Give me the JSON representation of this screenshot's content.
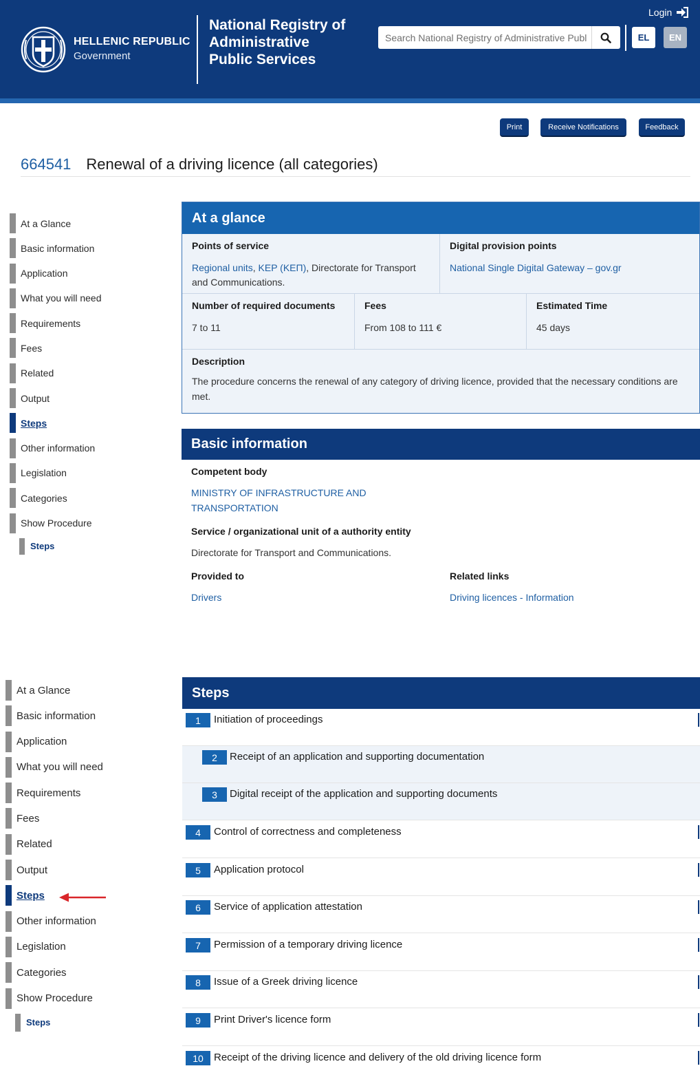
{
  "header": {
    "gov_title": "HELLENIC REPUBLIC",
    "gov_subtitle": "Government",
    "registry_title": "National Registry of Administrative Public Services",
    "login_label": "Login",
    "search_placeholder": "Search National Registry of Administrative Publ",
    "lang_el": "EL",
    "lang_en": "EN"
  },
  "actions": {
    "print": "Print",
    "notifications": "Receive Notifications",
    "feedback": "Feedback"
  },
  "page": {
    "id": "664541",
    "title": "Renewal of a driving licence (all categories)"
  },
  "sidebar_items": [
    "At a Glance",
    "Basic information",
    "Application",
    "What you will need",
    "Requirements",
    "Fees",
    "Related",
    "Output",
    "Steps",
    "Other information",
    "Legislation",
    "Categories",
    "Show Procedure"
  ],
  "sidebar_sub": "Steps",
  "glance": {
    "heading": "At a glance",
    "points_label": "Points of service",
    "points_link1": "Regional units",
    "points_sep1": ", ",
    "points_link2": "KEP (ΚΕΠ)",
    "points_rest": ", Directorate for Transport and Communications.",
    "digital_label": "Digital provision points",
    "digital_value": "National Single Digital Gateway – gov.gr",
    "docs_label": "Number of required documents",
    "docs_value": "7 to 11",
    "fees_label": "Fees",
    "fees_value": "From 108 to 111 €",
    "time_label": "Estimated Time",
    "time_value": "45 days",
    "desc_label": "Description",
    "desc_value": "The procedure concerns the renewal of any category of driving licence, provided that the necessary conditions are met."
  },
  "basic": {
    "heading": "Basic information",
    "competent_label": "Competent body",
    "competent_value": "MINISTRY OF INFRASTRUCTURE AND TRANSPORTATION",
    "unit_label": "Service / organizational unit of a authority entity",
    "unit_value": "Directorate for Transport and Communications.",
    "provided_label": "Provided to",
    "provided_value": "Drivers",
    "related_label": "Related links",
    "related_value": "Driving licences - Information"
  },
  "steps": {
    "heading": "Steps",
    "items": [
      {
        "num": "1",
        "text": "Initiation of proceedings"
      },
      {
        "num": "2",
        "text": "Receipt of an application and supporting documentation"
      },
      {
        "num": "3",
        "text": "Digital receipt of the application and supporting documents"
      },
      {
        "num": "4",
        "text": "Control of correctness and completeness"
      },
      {
        "num": "5",
        "text": "Application protocol"
      },
      {
        "num": "6",
        "text": "Service of application attestation"
      },
      {
        "num": "7",
        "text": "Permission of a temporary driving licence"
      },
      {
        "num": "8",
        "text": "Issue of a Greek driving licence"
      },
      {
        "num": "9",
        "text": "Print Driver's licence form"
      },
      {
        "num": "10",
        "text": "Receipt of the driving licence and delivery of the old driving licence form"
      }
    ]
  },
  "colors": {
    "header_bg": "#0e3a7c",
    "accent_blue": "#1765b0",
    "link": "#1f5fa3",
    "arrow": "#d9262a"
  }
}
